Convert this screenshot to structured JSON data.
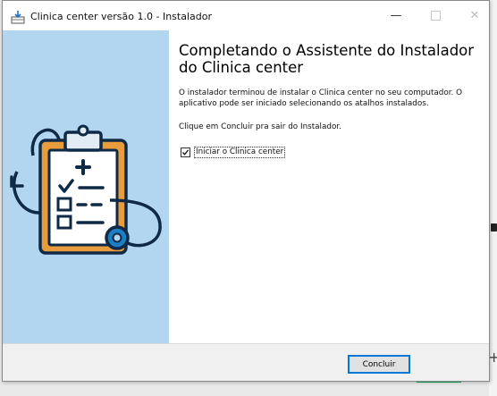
{
  "window": {
    "title": "Clinica center versão 1.0 - Instalador",
    "controls": {
      "minimize": "—",
      "close": "✕"
    }
  },
  "content": {
    "heading_line1": "Completando o Assistente do Instalador",
    "heading_line2": "do Clinica center",
    "paragraph1_line1": "O instalador terminou de instalar o Clinica center no seu computador. O",
    "paragraph1_line2": "aplicativo pode ser iniciado selecionando os atalhos instalados.",
    "paragraph2": "Clique em Concluir pra sair do Instalador.",
    "launch_checkbox": {
      "label": "Iniciar o Clinica center",
      "checked": true
    }
  },
  "footer": {
    "finish_button": "Concluir"
  },
  "icons": {
    "app": "installer-box-icon",
    "illustration": "clipboard-stethoscope-icon"
  },
  "colors": {
    "sidebar": "#b3d6f0",
    "clipboard": "#e99c3c",
    "ink": "#0e2a47",
    "accent_button_border": "#0078d7"
  }
}
